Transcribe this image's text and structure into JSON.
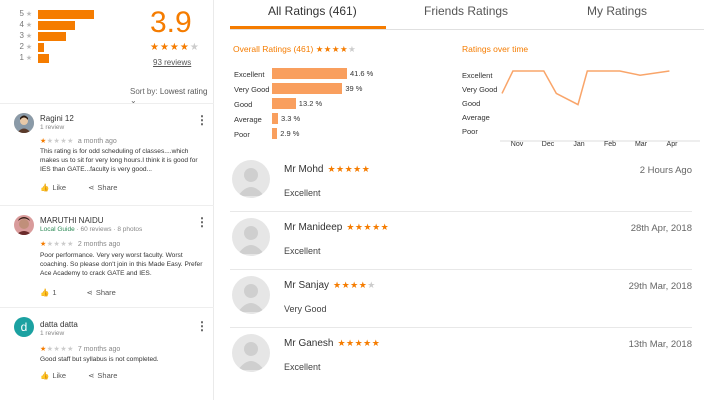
{
  "summary": {
    "rating": "3.9",
    "stars": "★★★★",
    "star_empty": "★",
    "review_count": "93 reviews",
    "histogram": [
      {
        "label": "5",
        "fraction": 1.0
      },
      {
        "label": "4",
        "fraction": 0.66
      },
      {
        "label": "3",
        "fraction": 0.5
      },
      {
        "label": "2",
        "fraction": 0.1
      },
      {
        "label": "1",
        "fraction": 0.2
      }
    ],
    "sort_label": "Sort by:",
    "sort_value": "Lowest rating"
  },
  "reviews": [
    {
      "name": "Ragini 12",
      "sub": "1 review",
      "guide": "",
      "stars_filled": "★",
      "stars_empty": "★★★★",
      "date": "a month ago",
      "text": "This rating is for odd scheduling of classes....which makes us to sit for very long hours.I think it is good for IES than GATE...faculty is very good...",
      "like": "Like",
      "share": "Share"
    },
    {
      "name": "MARUTHI NAIDU",
      "sub": "· 60 reviews · 8 photos",
      "guide": "Local Guide",
      "stars_filled": "★",
      "stars_empty": "★★★★",
      "date": "2 months ago",
      "text": "Poor performance. Very very worst faculty. Worst coaching. So please don't join in this Made Easy. Prefer Ace Academy to crack GATE and IES.",
      "like": "1",
      "share": "Share"
    },
    {
      "name": "datta datta",
      "sub": "1 review",
      "guide": "",
      "avatar_letter": "d",
      "stars_filled": "★",
      "stars_empty": "★★★★",
      "date": "7 months ago",
      "text": "Good staff but syllabus is not completed.",
      "like": "Like",
      "share": "Share"
    }
  ],
  "tabs": [
    "All Ratings (461)",
    "Friends Ratings",
    "My Ratings"
  ],
  "overall": {
    "title": "Overall Ratings (461)",
    "stars": "★★★★",
    "star_empty": "★",
    "rows": [
      {
        "label": "Excellent",
        "value": "41.6 %",
        "percent": 41.6
      },
      {
        "label": "Very Good",
        "value": "39 %",
        "percent": 39
      },
      {
        "label": "Good",
        "value": "13.2 %",
        "percent": 13.2
      },
      {
        "label": "Average",
        "value": "3.3 %",
        "percent": 3.3
      },
      {
        "label": "Poor",
        "value": "2.9 %",
        "percent": 2.9
      }
    ]
  },
  "over_time": {
    "title": "Ratings over time",
    "levels": [
      "Excellent",
      "Very Good",
      "Good",
      "Average",
      "Poor"
    ],
    "months": [
      "Nov",
      "Dec",
      "Jan",
      "Feb",
      "Mar",
      "Apr"
    ],
    "color": "#f9a56a",
    "points": [
      {
        "x": 0.0,
        "level": 1.6
      },
      {
        "x": 0.35,
        "level": 0.0
      },
      {
        "x": 1.35,
        "level": 0.0
      },
      {
        "x": 1.75,
        "level": 1.6
      },
      {
        "x": 2.45,
        "level": 2.4
      },
      {
        "x": 2.75,
        "level": 0.0
      },
      {
        "x": 3.8,
        "level": 0.0
      },
      {
        "x": 4.45,
        "level": 0.3
      },
      {
        "x": 5.4,
        "level": 0.0
      }
    ]
  },
  "entries": [
    {
      "name": "Mr Mohd",
      "stars": "★★★★★",
      "star_empty": "",
      "date": "2 Hours Ago",
      "label": "Excellent"
    },
    {
      "name": "Mr Manideep",
      "stars": "★★★★★",
      "star_empty": "",
      "date": "28th Apr, 2018",
      "label": "Excellent"
    },
    {
      "name": "Mr Sanjay",
      "stars": "★★★★",
      "star_empty": "★",
      "date": "29th Mar, 2018",
      "label": "Very Good"
    },
    {
      "name": "Mr Ganesh",
      "stars": "★★★★★",
      "star_empty": "",
      "date": "13th Mar, 2018",
      "label": "Excellent"
    }
  ],
  "colors": {
    "accent": "#f57c00",
    "bar": "#f99f5e",
    "local_guide": "#2e8b57"
  }
}
